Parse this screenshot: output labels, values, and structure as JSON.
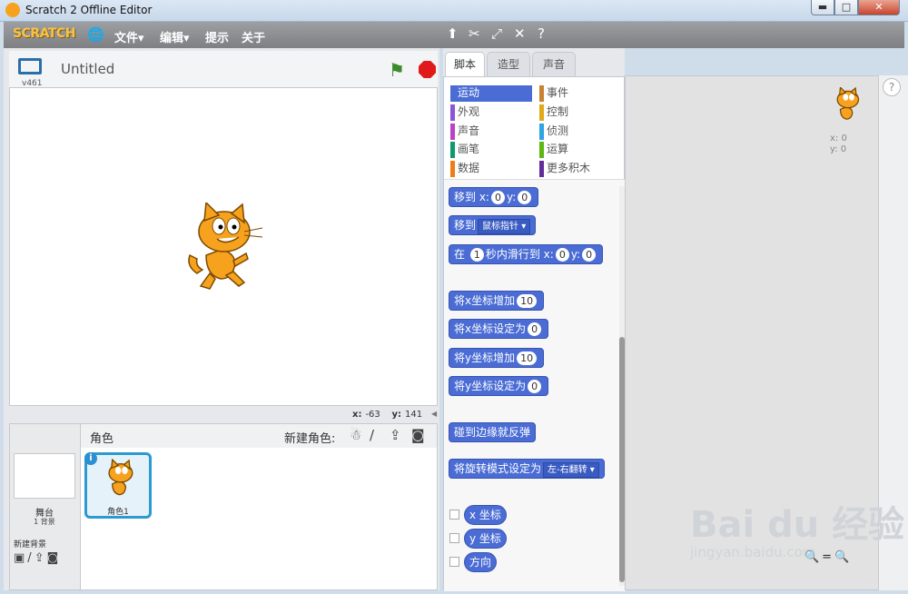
{
  "window": {
    "title": "Scratch 2 Offline Editor",
    "min": "▬",
    "max": "□",
    "close": "✕"
  },
  "menubar": {
    "logo": "SCRATCH",
    "menus": [
      "文件▾",
      "编辑▾",
      "提示",
      "关于"
    ],
    "tool_icons": [
      "stamp-icon",
      "scissors-icon",
      "grow-icon",
      "shrink-icon",
      "help-icon"
    ]
  },
  "stage": {
    "version": "v461",
    "project_title": "Untitled",
    "coords": {
      "x_label": "x:",
      "x": "-63",
      "y_label": "y:",
      "y": "141"
    }
  },
  "sprites": {
    "title": "角色",
    "new_sprite_label": "新建角色:",
    "stage_name": "舞台",
    "stage_backdrops": "1 背景",
    "new_backdrop_label": "新建背景",
    "sprite_name": "角色1"
  },
  "tabs": [
    "脚本",
    "造型",
    "声音"
  ],
  "categories": [
    {
      "label": "运动",
      "color": "#4a6cd4"
    },
    {
      "label": "事件",
      "color": "#c88330"
    },
    {
      "label": "外观",
      "color": "#8a55d7"
    },
    {
      "label": "控制",
      "color": "#e1a91a"
    },
    {
      "label": "声音",
      "color": "#bb42c3"
    },
    {
      "label": "侦测",
      "color": "#2ca5e2"
    },
    {
      "label": "画笔",
      "color": "#0e9a6c"
    },
    {
      "label": "运算",
      "color": "#5cb712"
    },
    {
      "label": "数据",
      "color": "#ee7d16"
    },
    {
      "label": "更多积木",
      "color": "#632d99"
    }
  ],
  "blocks": {
    "goto_xy": {
      "a": "移到 x:",
      "x": "0",
      "b": "y:",
      "y": "0"
    },
    "goto_pointer": {
      "a": "移到",
      "drop": "鼠标指针 ▾"
    },
    "glide": {
      "a": "在",
      "secs": "1",
      "b": "秒内滑行到 x:",
      "x": "0",
      "c": "y:",
      "y": "0"
    },
    "change_x": {
      "a": "将x坐标增加",
      "v": "10"
    },
    "set_x": {
      "a": "将x坐标设定为",
      "v": "0"
    },
    "change_y": {
      "a": "将y坐标增加",
      "v": "10"
    },
    "set_y": {
      "a": "将y坐标设定为",
      "v": "0"
    },
    "bounce": {
      "a": "碰到边缘就反弹"
    },
    "rotation_style": {
      "a": "将旋转模式设定为",
      "drop": "左-右翻转 ▾"
    },
    "reporters": [
      "x 坐标",
      "y 坐标",
      "方向"
    ]
  },
  "scripts": {
    "x": "x: 0",
    "y": "y: 0",
    "help": "?",
    "zoom": "🔍=🔍"
  },
  "watermark": {
    "big": "Bai du 经验",
    "small": "jingyan.baidu.com"
  }
}
